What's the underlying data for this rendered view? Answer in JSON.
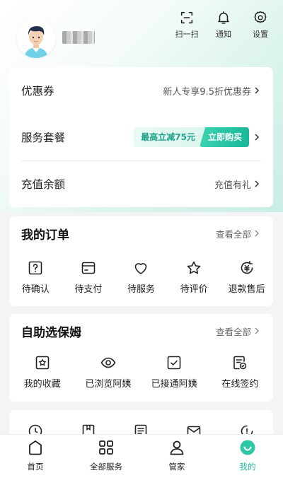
{
  "header": {
    "actions": [
      {
        "label": "扫一扫",
        "icon": "scan-icon"
      },
      {
        "label": "通知",
        "icon": "bell-icon"
      },
      {
        "label": "设置",
        "icon": "gear-icon"
      }
    ]
  },
  "account": {
    "coupon": {
      "title": "优惠券",
      "value": "新人专享9.5折优惠券"
    },
    "package": {
      "title": "服务套餐",
      "promo_text": "最高立减75元",
      "promo_button": "立即购买"
    },
    "balance": {
      "title": "充值余额",
      "value": "充值有礼"
    }
  },
  "orders": {
    "title": "我的订单",
    "more": "查看全部",
    "items": [
      {
        "label": "待确认",
        "icon": "question-icon"
      },
      {
        "label": "待支付",
        "icon": "card-icon"
      },
      {
        "label": "待服务",
        "icon": "heart-icon"
      },
      {
        "label": "待评价",
        "icon": "star-icon"
      },
      {
        "label": "退款售后",
        "icon": "refund-icon"
      }
    ]
  },
  "nanny": {
    "title": "自助选保姆",
    "more": "查看全部",
    "items": [
      {
        "label": "我的收藏",
        "icon": "star-box-icon"
      },
      {
        "label": "已浏览阿姨",
        "icon": "eye-icon"
      },
      {
        "label": "已接通阿姨",
        "icon": "check-box-icon"
      },
      {
        "label": "在线签约",
        "icon": "contract-icon"
      }
    ]
  },
  "tabbar": {
    "items": [
      {
        "label": "首页",
        "icon": "home-icon"
      },
      {
        "label": "全部服务",
        "icon": "grid-icon"
      },
      {
        "label": "管家",
        "icon": "person-icon"
      },
      {
        "label": "我的",
        "icon": "smile-icon",
        "active": true
      }
    ]
  },
  "colors": {
    "accent": "#1fb89a",
    "accent_light": "#dcf5ee"
  }
}
